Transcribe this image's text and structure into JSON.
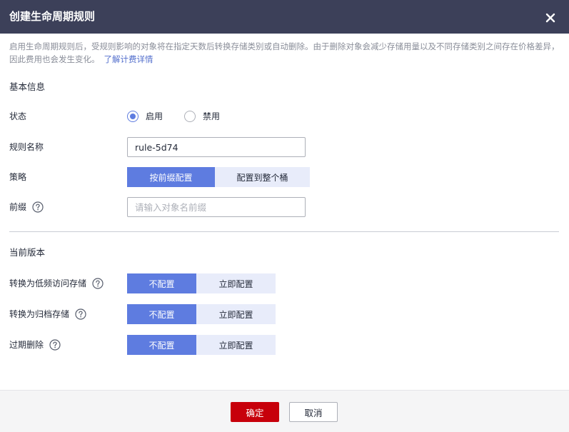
{
  "dialog": {
    "title": "创建生命周期规则",
    "close_icon": "close-icon",
    "description": "启用生命周期规则后，受规则影响的对象将在指定天数后转换存储类别或自动删除。由于删除对象会减少存储用量以及不同存储类别之间存在价格差异，因此费用也会发生变化。",
    "learn_more": "了解计费详情"
  },
  "basic": {
    "section_title": "基本信息",
    "status": {
      "label": "状态",
      "enabled": "启用",
      "disabled": "禁用",
      "selected": "enabled"
    },
    "rule_name": {
      "label": "规则名称",
      "value": "rule-5d74"
    },
    "policy": {
      "label": "策略",
      "by_prefix": "按前缀配置",
      "whole_bucket": "配置到整个桶",
      "selected": "by_prefix"
    },
    "prefix": {
      "label": "前缀",
      "placeholder": "请输入对象名前缀",
      "value": ""
    }
  },
  "current_version": {
    "section_title": "当前版本",
    "rows": [
      {
        "label": "转换为低频访问存储",
        "off": "不配置",
        "on": "立即配置",
        "selected": "off"
      },
      {
        "label": "转换为归档存储",
        "off": "不配置",
        "on": "立即配置",
        "selected": "off"
      },
      {
        "label": "过期删除",
        "off": "不配置",
        "on": "立即配置",
        "selected": "off"
      }
    ]
  },
  "footer": {
    "ok": "确定",
    "cancel": "取消"
  },
  "colors": {
    "header_bg": "#3c4059",
    "primary": "#5e7ce0",
    "primary_light": "#e8ecfa",
    "danger": "#c7000b",
    "link": "#526ecc"
  }
}
